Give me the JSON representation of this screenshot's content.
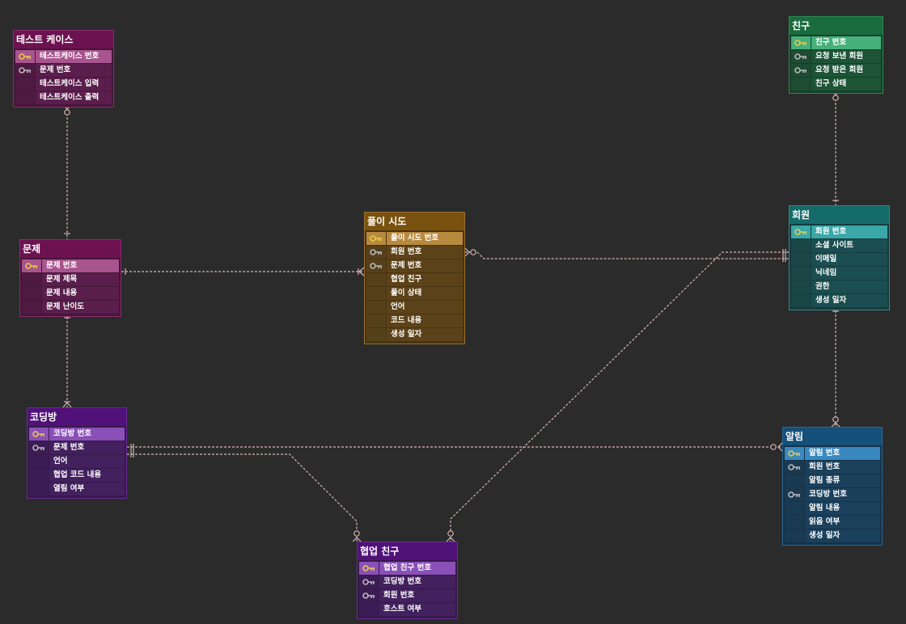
{
  "colors": {
    "background": "#2b2b2b",
    "relation_line": "#d8b4b4",
    "pk_key": "#e8c84a",
    "fk_key": "#b8b8b8"
  },
  "entities": [
    {
      "id": "testcase",
      "title": "테스트 케이스",
      "palette": {
        "border": "#8a2a6e",
        "title": "#6d1250",
        "body": "#45163a",
        "row": "#5a1e4c",
        "pk": "#a8548e",
        "icon": "#4e1a42"
      },
      "columns": [
        {
          "label": "테스트케이스 번호",
          "key": "pk"
        },
        {
          "label": "문제 번호",
          "key": "fk"
        },
        {
          "label": "테스트케이스 입력",
          "key": "none"
        },
        {
          "label": "테스트케이스 출력",
          "key": "none"
        }
      ]
    },
    {
      "id": "friend",
      "title": "친구",
      "palette": {
        "border": "#2f8a58",
        "title": "#1a6b3e",
        "body": "#163f2a",
        "row": "#1d5436",
        "pk": "#46b07a",
        "icon": "#1d4c33"
      },
      "columns": [
        {
          "label": "친구 번호",
          "key": "pk"
        },
        {
          "label": "요청 보낸 회원",
          "key": "fk"
        },
        {
          "label": "요청 받은 회원",
          "key": "fk"
        },
        {
          "label": "친구 상태",
          "key": "none"
        }
      ]
    },
    {
      "id": "problem",
      "title": "문제",
      "palette": {
        "border": "#8a2a6e",
        "title": "#6d1250",
        "body": "#45163a",
        "row": "#5a1e4c",
        "pk": "#a8548e",
        "icon": "#4e1a42"
      },
      "columns": [
        {
          "label": "문제 번호",
          "key": "pk"
        },
        {
          "label": "문제 제목",
          "key": "none"
        },
        {
          "label": "문제 내용",
          "key": "none"
        },
        {
          "label": "문제 난이도",
          "key": "none"
        }
      ]
    },
    {
      "id": "attempt",
      "title": "풀이 시도",
      "palette": {
        "border": "#9a7030",
        "title": "#7a5210",
        "body": "#4a3410",
        "row": "#5c4218",
        "pk": "#b88a3e",
        "icon": "#54401a"
      },
      "columns": [
        {
          "label": "풀이 시도 번호",
          "key": "pk"
        },
        {
          "label": "회원 번호",
          "key": "fk"
        },
        {
          "label": "문제 번호",
          "key": "fk"
        },
        {
          "label": "협업 친구",
          "key": "none"
        },
        {
          "label": "풀이 상태",
          "key": "none"
        },
        {
          "label": "언어",
          "key": "none"
        },
        {
          "label": "코드 내용",
          "key": "none"
        },
        {
          "label": "생성 일자",
          "key": "none"
        }
      ]
    },
    {
      "id": "member",
      "title": "회원",
      "palette": {
        "border": "#2a8a8a",
        "title": "#156a6a",
        "body": "#153c3e",
        "row": "#1b4e50",
        "pk": "#3aa8a8",
        "icon": "#1a4647"
      },
      "columns": [
        {
          "label": "회원 번호",
          "key": "pk"
        },
        {
          "label": "소셜 사이트",
          "key": "none"
        },
        {
          "label": "이메일",
          "key": "none"
        },
        {
          "label": "닉네임",
          "key": "none"
        },
        {
          "label": "권한",
          "key": "none"
        },
        {
          "label": "생성 일자",
          "key": "none"
        }
      ]
    },
    {
      "id": "codingroom",
      "title": "코딩방",
      "palette": {
        "border": "#6a2a9a",
        "title": "#501278",
        "body": "#351a4a",
        "row": "#43205e",
        "pk": "#8a50b8",
        "icon": "#3c1c54"
      },
      "columns": [
        {
          "label": "코딩방 번호",
          "key": "pk"
        },
        {
          "label": "문제 번호",
          "key": "fk"
        },
        {
          "label": "언어",
          "key": "none"
        },
        {
          "label": "협업 코드 내용",
          "key": "none"
        },
        {
          "label": "열림 여부",
          "key": "none"
        }
      ]
    },
    {
      "id": "notice",
      "title": "알림",
      "palette": {
        "border": "#2a6a9a",
        "title": "#14507a",
        "body": "#15324a",
        "row": "#1b405c",
        "pk": "#3a88c0",
        "icon": "#1a3a52"
      },
      "columns": [
        {
          "label": "알림 번호",
          "key": "pk"
        },
        {
          "label": "회원 번호",
          "key": "fk"
        },
        {
          "label": "알림 종류",
          "key": "none"
        },
        {
          "label": "코딩방 번호",
          "key": "fk"
        },
        {
          "label": "알림 내용",
          "key": "none"
        },
        {
          "label": "읽음 여부",
          "key": "none"
        },
        {
          "label": "생성 일자",
          "key": "none"
        }
      ]
    },
    {
      "id": "collab",
      "title": "협업 친구",
      "palette": {
        "border": "#6a2a9a",
        "title": "#501278",
        "body": "#351a4a",
        "row": "#43205e",
        "pk": "#8a50b8",
        "icon": "#3c1c54"
      },
      "columns": [
        {
          "label": "협업 친구 번호",
          "key": "pk"
        },
        {
          "label": "코딩방 번호",
          "key": "fk"
        },
        {
          "label": "회원 번호",
          "key": "fk"
        },
        {
          "label": "호스트 여부",
          "key": "none"
        }
      ]
    }
  ],
  "relationships": [
    {
      "from": "testcase",
      "to": "problem",
      "from_end": "zero-or-many",
      "to_end": "one"
    },
    {
      "from": "friend",
      "to": "member",
      "from_end": "zero-or-many",
      "to_end": "one"
    },
    {
      "from": "problem",
      "to": "attempt",
      "from_end": "one",
      "to_end": "one-or-many"
    },
    {
      "from": "problem",
      "to": "codingroom",
      "from_end": "one",
      "to_end": "one-or-many"
    },
    {
      "from": "attempt",
      "to": "member",
      "from_end": "zero-or-many",
      "to_end": "one"
    },
    {
      "from": "member",
      "to": "notice",
      "from_end": "one",
      "to_end": "zero-or-many"
    },
    {
      "from": "codingroom",
      "to": "notice",
      "from_end": "one",
      "to_end": "zero-or-many"
    },
    {
      "from": "codingroom",
      "to": "collab",
      "from_end": "one",
      "to_end": "zero-or-many"
    },
    {
      "from": "member",
      "to": "collab",
      "from_end": "one",
      "to_end": "zero-or-many"
    }
  ]
}
